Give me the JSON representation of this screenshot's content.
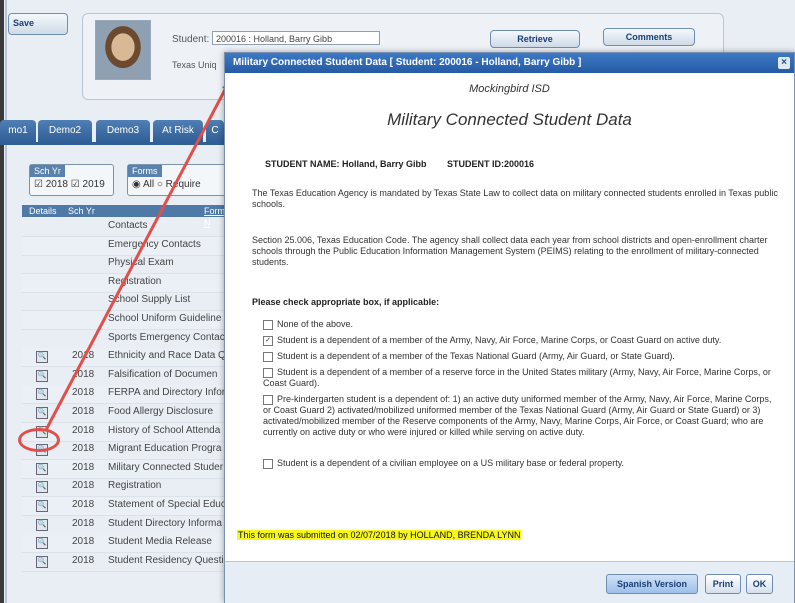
{
  "toolbar": {
    "save_label": "Save"
  },
  "student_panel": {
    "student_label": "Student:",
    "student_value": "200016 : Holland, Barry Gibb",
    "texas_label": "Texas Uniq",
    "retrieve_label": "Retrieve",
    "comments_label": "Comments"
  },
  "tabs": [
    "mo1",
    "Demo2",
    "Demo3",
    "At Risk",
    "C"
  ],
  "filters": {
    "sch_yr_title": "Sch Yr",
    "sch_yr_values": "☑ 2018  ☑ 2019",
    "forms_title": "Forms",
    "forms_values": "◉ All  ○ Require"
  },
  "grid": {
    "headers": {
      "details": "Details",
      "sch_yr": "Sch Yr",
      "form": "Form N"
    },
    "rows": [
      {
        "year": "",
        "form": "Contacts",
        "details": false
      },
      {
        "year": "",
        "form": "Emergency Contacts",
        "details": false
      },
      {
        "year": "",
        "form": "Physical Exam",
        "details": false
      },
      {
        "year": "",
        "form": "Registration",
        "details": false
      },
      {
        "year": "",
        "form": "School Supply List",
        "details": false
      },
      {
        "year": "",
        "form": "School Uniform Guideline",
        "details": false
      },
      {
        "year": "",
        "form": "Sports Emergency Contac",
        "details": false
      },
      {
        "year": "2018",
        "form": "Ethnicity and Race Data Q",
        "details": true
      },
      {
        "year": "2018",
        "form": "Falsification of Documen",
        "details": true
      },
      {
        "year": "2018",
        "form": "FERPA and Directory Infor",
        "details": true
      },
      {
        "year": "2018",
        "form": "Food Allergy Disclosure",
        "details": true
      },
      {
        "year": "2018",
        "form": "History of School Attenda",
        "details": true
      },
      {
        "year": "2018",
        "form": "Migrant Education Progra",
        "details": true
      },
      {
        "year": "2018",
        "form": "Military Connected Studer",
        "details": true
      },
      {
        "year": "2018",
        "form": "Registration",
        "details": true
      },
      {
        "year": "2018",
        "form": "Statement of Special Educ",
        "details": true
      },
      {
        "year": "2018",
        "form": "Student Directory Informa",
        "details": true
      },
      {
        "year": "2018",
        "form": "Student Media Release",
        "details": true
      },
      {
        "year": "2018",
        "form": "Student Residency Questi",
        "details": true
      }
    ]
  },
  "modal": {
    "title": "Military Connected Student Data [ Student: 200016 - Holland, Barry Gibb ]",
    "close_glyph": "×",
    "org": "Mockingbird ISD",
    "form_title": "Military Connected Student Data",
    "student_name": "STUDENT NAME: Holland, Barry Gibb",
    "student_id": "STUDENT ID:200016",
    "para1": "The Texas Education Agency is mandated by Texas State Law to collect data on military connected students enrolled in Texas public schools.",
    "para2": "Section 25.006, Texas Education Code. The agency shall collect data each year from school districts and open-enrollment charter schools through the Public Education Information Management System (PEIMS) relating to the enrollment of military-connected students.",
    "check_header": "Please check appropriate box, if applicable:",
    "options": [
      {
        "checked": false,
        "text": "None of the above."
      },
      {
        "checked": true,
        "text": "Student is a dependent of a member of the Army, Navy, Air Force, Marine Corps, or Coast Guard on active duty."
      },
      {
        "checked": false,
        "text": "Student is a dependent of a member of the Texas National Guard (Army, Air Guard, or State Guard)."
      },
      {
        "checked": false,
        "text": "Student is a dependent of a member of a reserve force in the United States military (Army, Navy, Air Force, Marine Corps, or Coast Guard)."
      },
      {
        "checked": false,
        "text": "Pre-kindergarten student is a dependent of: 1) an active duty uniformed member of the Army, Navy, Air Force, Marine Corps, or Coast Guard 2) activated/mobilized uniformed member of the Texas National Guard (Army, Air Guard or State Guard) or 3) activated/mobilized member of the Reserve components of the Army, Navy, Marine Corps, Air Force, or Coast Guard; who are currently on active duty or who were injured or killed while serving on active duty."
      },
      {
        "checked": false,
        "text": "Student is a dependent of a civilian employee on a US military base or federal property."
      }
    ],
    "submitted": "This form was submitted on 02/07/2018 by HOLLAND, BRENDA LYNN",
    "buttons": {
      "spanish": "Spanish Version",
      "print": "Print",
      "ok": "OK"
    }
  },
  "colors": {
    "accent": "#2f5f96",
    "annotation": "#e0504a",
    "highlight": "#f7f71a"
  }
}
